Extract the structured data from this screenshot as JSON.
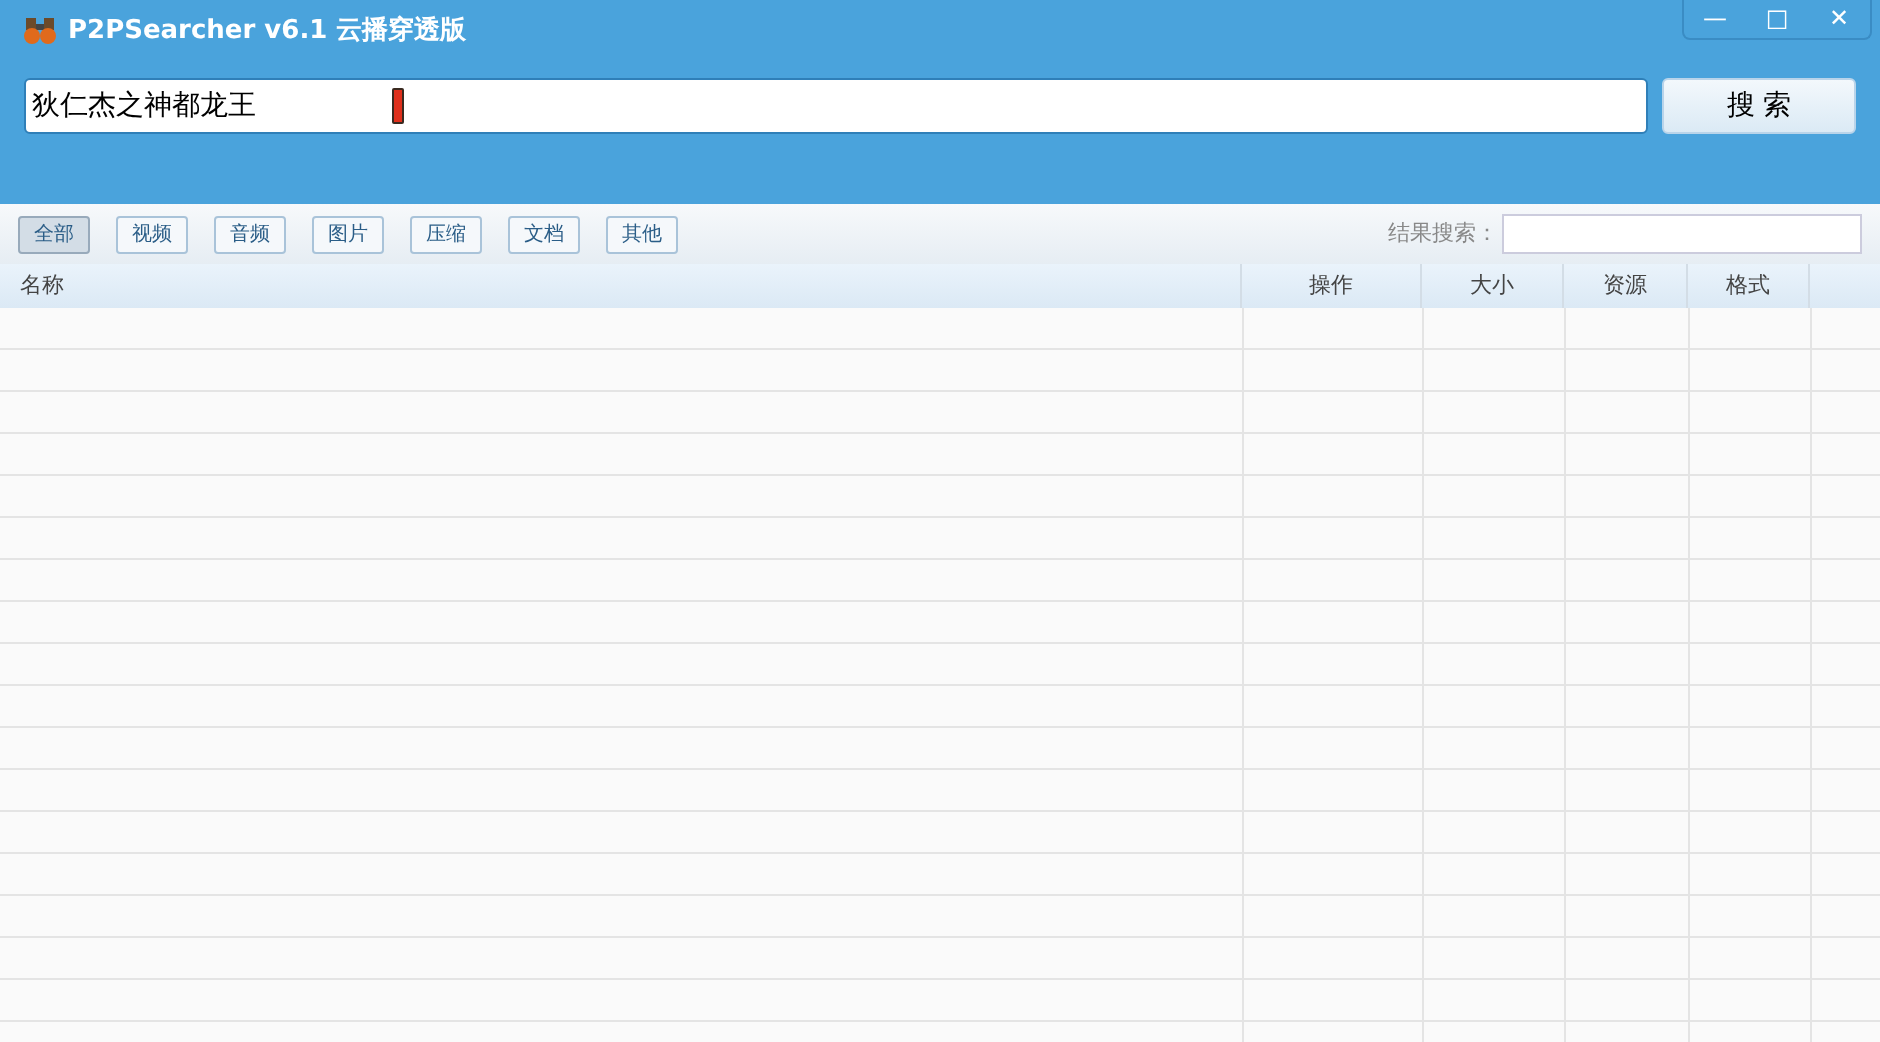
{
  "window": {
    "title": "P2PSearcher v6.1 云播穿透版"
  },
  "window_controls": [
    "—",
    "□",
    "✕"
  ],
  "search": {
    "value": "狄仁杰之神都龙王",
    "button": "搜 索"
  },
  "filters": [
    {
      "label": "全部",
      "selected": true
    },
    {
      "label": "视频",
      "selected": false
    },
    {
      "label": "音频",
      "selected": false
    },
    {
      "label": "图片",
      "selected": false
    },
    {
      "label": "压缩",
      "selected": false
    },
    {
      "label": "文档",
      "selected": false
    },
    {
      "label": "其他",
      "selected": false
    }
  ],
  "result_search": {
    "label": "结果搜索："
  },
  "table": {
    "columns": [
      "名称",
      "操作",
      "大小",
      "资源",
      "格式"
    ]
  }
}
